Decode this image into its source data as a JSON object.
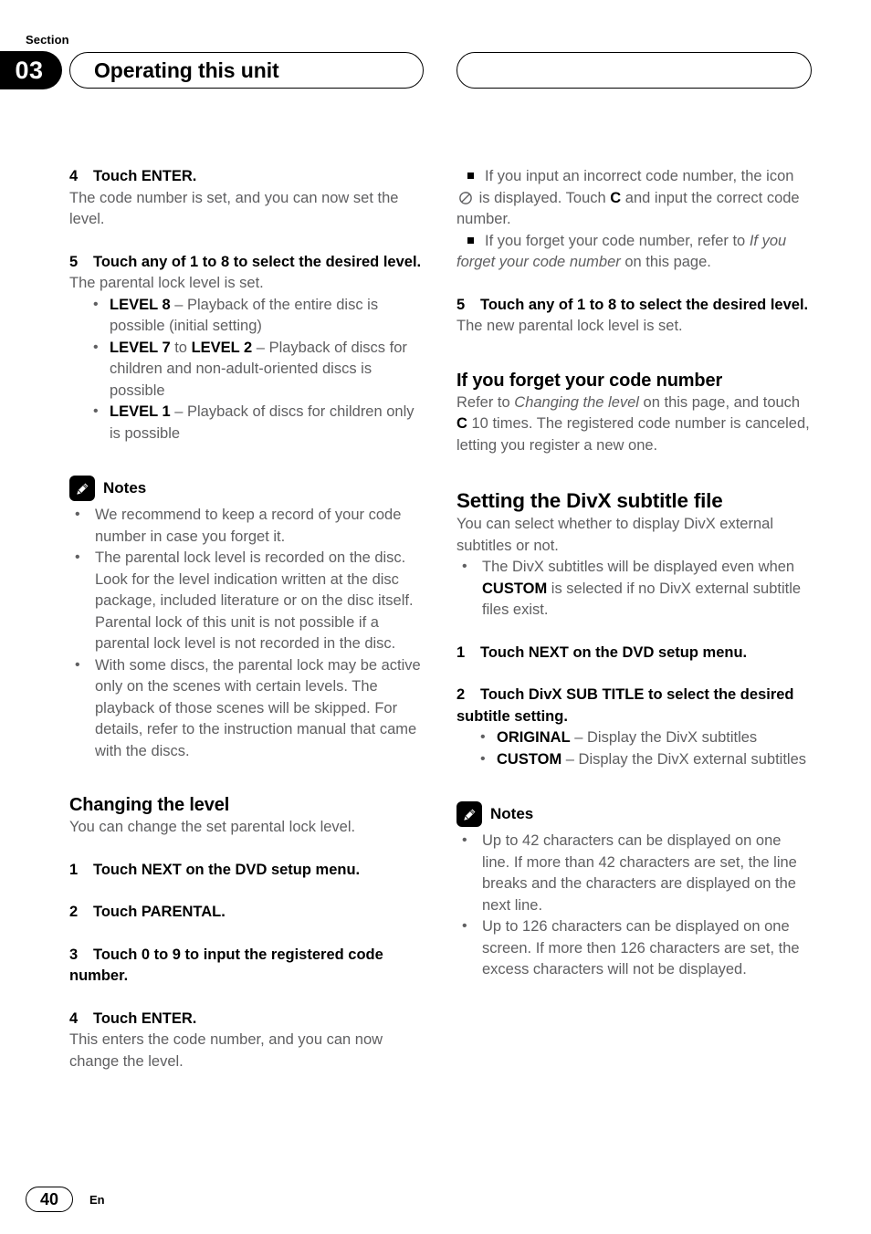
{
  "header": {
    "section_label": "Section",
    "section_number": "03",
    "title": "Operating this unit"
  },
  "footer": {
    "page_number": "40",
    "language_code": "En"
  },
  "left_column": {
    "step4": {
      "number": "4",
      "title": "Touch ENTER.",
      "body": "The code number is set, and you can now set the level."
    },
    "step5": {
      "number": "5",
      "title": "Touch any of 1 to 8 to select the desired level.",
      "body": "The parental lock level is set.",
      "options": [
        {
          "term": "LEVEL 8",
          "desc": " – Playback of the entire disc is possible (initial setting)"
        },
        {
          "term": "LEVEL 7",
          "term2": "LEVEL 2",
          "joiner": " to ",
          "desc": " – Playback of discs for children and non-adult-oriented discs is possible"
        },
        {
          "term": "LEVEL 1",
          "desc": " – Playback of discs for children only is possible"
        }
      ]
    },
    "notes": {
      "icon": "pencil-icon",
      "title": "Notes",
      "items": [
        "We recommend to keep a record of your code number in case you forget it.",
        "The parental lock level is recorded on the disc. Look for the level indication written at the disc package, included literature or on the disc itself. Parental lock of this unit is not possible if a parental lock level is not recorded in the disc.",
        "With some discs, the parental lock may be active only on the scenes with certain levels. The playback of those scenes will be skipped. For details, refer to the instruction manual that came with the discs."
      ]
    },
    "changing_the_level": {
      "heading": "Changing the level",
      "intro": "You can change the set parental lock level.",
      "step1": {
        "number": "1",
        "title": "Touch NEXT on the DVD setup menu."
      },
      "step2": {
        "number": "2",
        "title": "Touch PARENTAL."
      },
      "step3": {
        "number": "3",
        "title": "Touch 0 to 9 to input the registered code number."
      },
      "step4": {
        "number": "4",
        "title": "Touch ENTER.",
        "body": "This enters the code number, and you can now change the level."
      }
    }
  },
  "right_column": {
    "square_notes": {
      "note1_part1": "If you input an incorrect code number, the icon ",
      "note1_icon": "prohibition-icon",
      "note1_part2": " is displayed. Touch ",
      "note1_bold": "C",
      "note1_part3": " and input the correct code number.",
      "note2_part1": "If you forget your code number, refer to ",
      "note2_italic": "If you forget your code number",
      "note2_part2": " on this page."
    },
    "step5": {
      "number": "5",
      "title": "Touch any of 1 to 8 to select the desired level.",
      "body": "The new parental lock level is set."
    },
    "forgot_code": {
      "heading": "If you forget your code number",
      "body_part1": "Refer to ",
      "body_italic": "Changing the level",
      "body_part2": " on this page, and touch ",
      "body_bold": "C",
      "body_part3": " 10 times. The registered code number is canceled, letting you register a new one."
    },
    "divx": {
      "heading": "Setting the DivX subtitle file",
      "intro": "You can select whether to display DivX external subtitles or not.",
      "bullet_part1": "The DivX subtitles will be displayed even when ",
      "bullet_bold": "CUSTOM",
      "bullet_part2": " is selected if no DivX external subtitle files exist.",
      "step1": {
        "number": "1",
        "title": "Touch NEXT on the DVD setup menu."
      },
      "step2": {
        "number": "2",
        "title": "Touch DivX SUB TITLE to select the desired subtitle setting.",
        "options": [
          {
            "term": "ORIGINAL",
            "desc": " – Display the DivX subtitles"
          },
          {
            "term": "CUSTOM",
            "desc": " – Display the DivX external subtitles"
          }
        ]
      }
    },
    "notes": {
      "icon": "pencil-icon",
      "title": "Notes",
      "items": [
        "Up to 42 characters can be displayed on one line. If more than 42 characters are set, the line breaks and the characters are displayed on the next line.",
        "Up to 126 characters can be displayed on one screen. If more then 126 characters are set, the excess characters will not be displayed."
      ]
    }
  }
}
